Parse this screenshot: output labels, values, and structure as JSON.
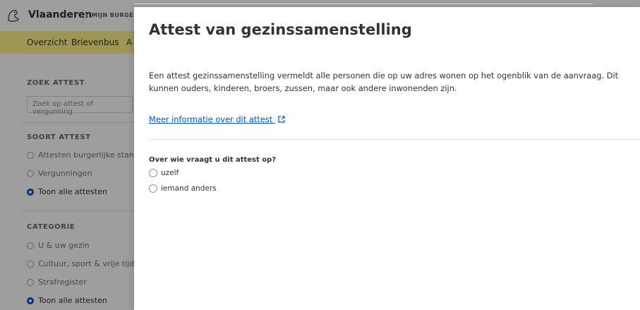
{
  "header": {
    "brand": "Vlaanderen",
    "subbrand": "MIJN BURGERPROFIEL"
  },
  "nav": {
    "items": [
      "Overzicht",
      "Brievenbus",
      "A"
    ]
  },
  "sidebar": {
    "search_label": "ZOEK ATTEST",
    "search_placeholder": "Zoek op attest of vergunning",
    "soort_label": "SOORT ATTEST",
    "soort_options": [
      "Attesten burgerlijke stand",
      "Vergunningen",
      "Toon alle attesten"
    ],
    "categorie_label": "CATEGORIE",
    "categorie_options": [
      "U & uw gezin",
      "Cultuur, sport & vrije tijd",
      "Strafregister",
      "Toon alle attesten"
    ]
  },
  "modal": {
    "title": "Attest van gezinssamenstelling",
    "description": "Een attest gezinssamenstelling vermeldt alle personen die op uw adres wonen op het ogenblik van de aanvraag. Dit kunnen ouders, kinderen, broers, zussen, maar ook andere inwonenden zijn.",
    "info_link": "Meer informatie over dit attest",
    "question": "Over wie vraagt u dit attest op?",
    "options": [
      "uzelf",
      "iemand anders"
    ]
  },
  "colors": {
    "nav_background": "#fff28a",
    "link": "#0055cc",
    "selected_radio": "#0055cc"
  }
}
